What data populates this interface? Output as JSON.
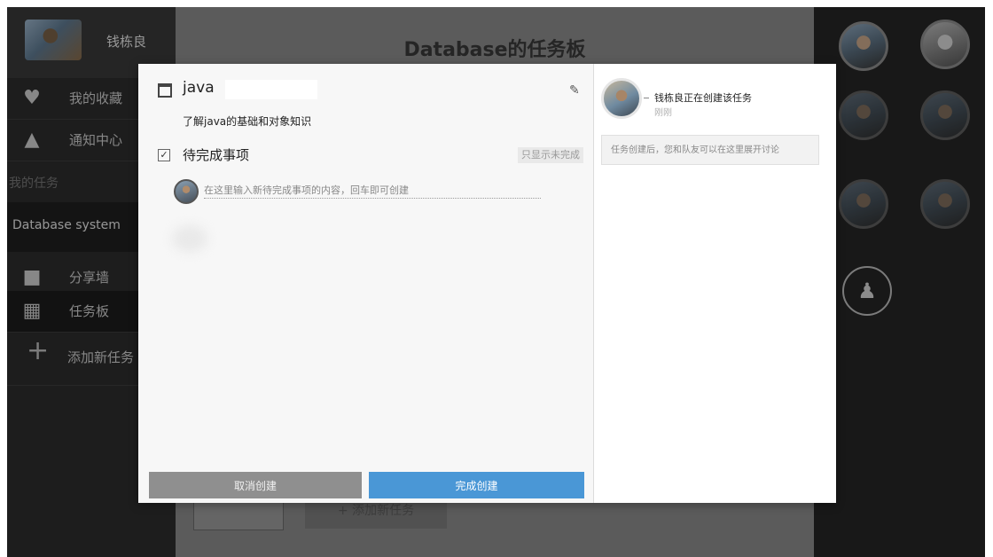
{
  "sidebar": {
    "user_name": "钱栋良",
    "nav": [
      {
        "label": "我的收藏",
        "icon": "heart-icon"
      },
      {
        "label": "通知中心",
        "icon": "bell-icon"
      }
    ],
    "section_label": "我的任务",
    "project": "Database system",
    "views": [
      {
        "label": "分享墙",
        "icon": "chat-bubble-icon"
      },
      {
        "label": "任务板",
        "icon": "calendar-icon"
      }
    ],
    "add_task": "添加新任务"
  },
  "board": {
    "title": "Database的任务板",
    "add_task_button": "+ 添加新任务"
  },
  "dialog": {
    "task_title": "java",
    "task_description": "了解java的基础和对象知识",
    "todo_heading": "待完成事项",
    "filter_label": "只显示未完成",
    "todo_placeholder": "在这里输入新待完成事项的内容，回车即可创建",
    "cancel_label": "取消创建",
    "confirm_label": "完成创建",
    "activity": {
      "text": "钱栋良正在创建该任务",
      "time": "刚刚",
      "note": "任务创建后，您和队友可以在这里展开讨论"
    }
  },
  "members": {
    "add_member_icon": "add-user-icon"
  },
  "colors": {
    "accent": "#4a97d6",
    "cancel": "#8f8f8f",
    "sidebar_bg": "#2d2d2d"
  }
}
